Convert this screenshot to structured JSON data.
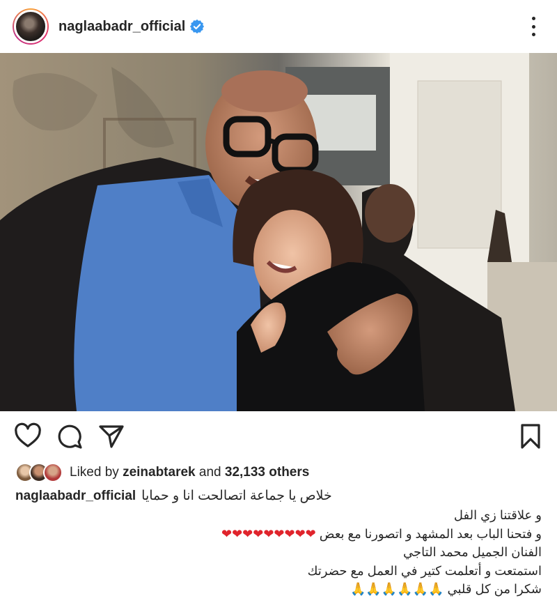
{
  "post": {
    "username": "naglaabadr_official",
    "verified": true,
    "avatar_icon": "profile-photo",
    "more_icon": "more-vertical-icon"
  },
  "actions": {
    "like_icon": "heart-icon",
    "comment_icon": "comment-icon",
    "share_icon": "send-icon",
    "save_icon": "bookmark-icon"
  },
  "likes": {
    "prefix": "Liked by",
    "user": "zeinabtarek",
    "joiner": "and",
    "count": "32,133 others"
  },
  "caption": {
    "username": "naglaabadr_official",
    "first_line": "خلاص يا جماعة اتصالحت انا و حمايا",
    "lines": [
      "و علاقتنا زي الفل",
      "و فتحنا الباب بعد المشهد و اتصورنا مع بعض",
      "الفنان الجميل محمد التاجي",
      "استمتعت و أتعلمت كتير في العمل مع حضرتك",
      "شكرا من كل قلبي"
    ],
    "hearts": "❤❤❤❤❤❤❤❤❤",
    "prayers": "🙏🙏🙏🙏🙏🙏"
  },
  "colors": {
    "text": "#262626",
    "verified_blue": "#3897f0",
    "heart_red": "#e0242c",
    "ring_start": "#f9a33a",
    "ring_end": "#c13584"
  }
}
